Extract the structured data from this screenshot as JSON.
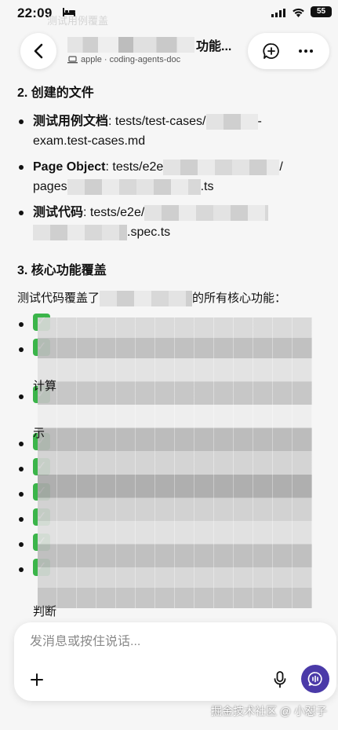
{
  "status_bar": {
    "time": "22:09",
    "battery": "55"
  },
  "header": {
    "ghost_text": "测试用例覆盖",
    "title_suffix": "功能...",
    "subtitle_owner": "apple",
    "subtitle_sep": "·",
    "subtitle_repo": "coding-agents-doc"
  },
  "content": {
    "section2_title": "2. 创建的文件",
    "files": [
      {
        "label": "测试用例文档",
        "sep": ": ",
        "text_a": "tests/test-cases/",
        "text_b": "-",
        "text_c": "exam.test-cases.md",
        "text_d": ""
      },
      {
        "label": "Page Object",
        "sep": ": ",
        "text_a": "tests/e2e",
        "text_b": "/",
        "text_c": "pages",
        "text_d": ".ts"
      },
      {
        "label": "测试代码",
        "sep": ": ",
        "text_a": "tests/e2e/",
        "text_b": "",
        "text_c": "",
        "text_d": ".spec.ts"
      }
    ],
    "section3_title": "3. 核心功能覆盖",
    "coverage_intro_a": "测试代码覆盖了",
    "coverage_intro_b": "的所有核心功能：",
    "check_symbol": "✓",
    "check_count": 9,
    "wrap_fragments": [
      "计算",
      "示",
      "判断"
    ]
  },
  "composer": {
    "placeholder": "发消息或按住说话..."
  },
  "watermark": "掘金技术社区 @ 小怼子"
}
